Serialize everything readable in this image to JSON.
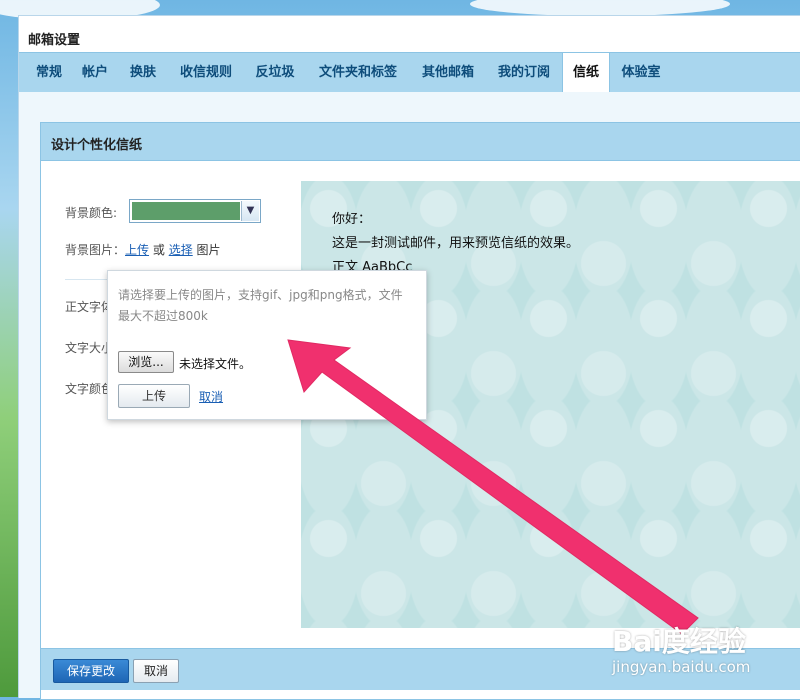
{
  "window": {
    "title": "邮箱设置"
  },
  "tabs": [
    {
      "label": "常规",
      "active": false
    },
    {
      "label": "帐户",
      "active": false
    },
    {
      "label": "换肤",
      "active": false
    },
    {
      "label": "收信规则",
      "active": false
    },
    {
      "label": "反垃圾",
      "active": false
    },
    {
      "label": "文件夹和标签",
      "active": false
    },
    {
      "label": "其他邮箱",
      "active": false
    },
    {
      "label": "我的订阅",
      "active": false
    },
    {
      "label": "信纸",
      "active": true
    },
    {
      "label": "体验室",
      "active": false
    }
  ],
  "panel": {
    "title": "设计个性化信纸"
  },
  "form": {
    "bg_color_label": "背景颜色:",
    "bg_color_value": "#5d9e6a",
    "bg_image_label": "背景图片：",
    "upload_link": "上传",
    "or_text": "或",
    "select_link": "选择",
    "image_text": "图片",
    "font_label": "正文字体",
    "size_label": "文字大小",
    "color_label": "文字颜色"
  },
  "preview": {
    "greeting": "你好：",
    "body": "这是一封测试邮件，用来预览信纸的效果。",
    "sample": "正文 AaBbCc"
  },
  "upload_popup": {
    "hint": "请选择要上传的图片，支持gif、jpg和png格式，文件最大不超过800k",
    "browse_button": "浏览...",
    "no_file": "未选择文件。",
    "upload_button": "上传",
    "cancel_link": "取消"
  },
  "footer": {
    "save_button": "保存更改",
    "cancel_button": "取消"
  },
  "watermark": {
    "logo": "Bai度经验",
    "url": "jingyan.baidu.com"
  },
  "colors": {
    "tab_bar": "#a9d6ee",
    "arrow": "#f0306e",
    "preview_bg": "#bfe1e2"
  }
}
